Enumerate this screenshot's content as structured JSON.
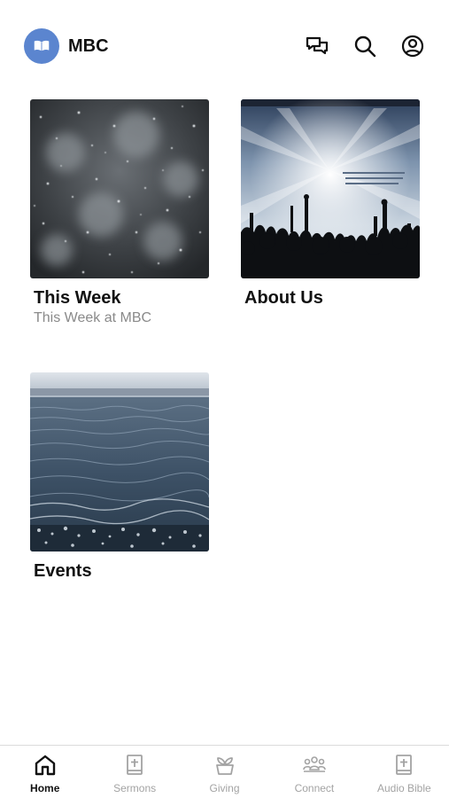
{
  "header": {
    "title": "MBC",
    "logo_icon": "bible-logo-icon",
    "actions": [
      {
        "name": "messages-icon"
      },
      {
        "name": "search-icon"
      },
      {
        "name": "profile-icon"
      }
    ]
  },
  "cards": [
    {
      "title": "This Week",
      "subtitle": "This Week at MBC",
      "image": "snowfall-image"
    },
    {
      "title": "About Us",
      "subtitle": "",
      "image": "worship-concert-image"
    },
    {
      "title": "Events",
      "subtitle": "",
      "image": "ocean-waves-image"
    }
  ],
  "tabbar": {
    "items": [
      {
        "label": "Home",
        "icon": "home-icon",
        "active": true
      },
      {
        "label": "Sermons",
        "icon": "bible-icon",
        "active": false
      },
      {
        "label": "Giving",
        "icon": "giving-icon",
        "active": false
      },
      {
        "label": "Connect",
        "icon": "people-icon",
        "active": false
      },
      {
        "label": "Audio Bible",
        "icon": "audio-bible-icon",
        "active": false
      }
    ]
  },
  "colors": {
    "logo_bg": "#5b85cf",
    "active_tab": "#111111",
    "inactive_tab": "#a3a3a3"
  }
}
